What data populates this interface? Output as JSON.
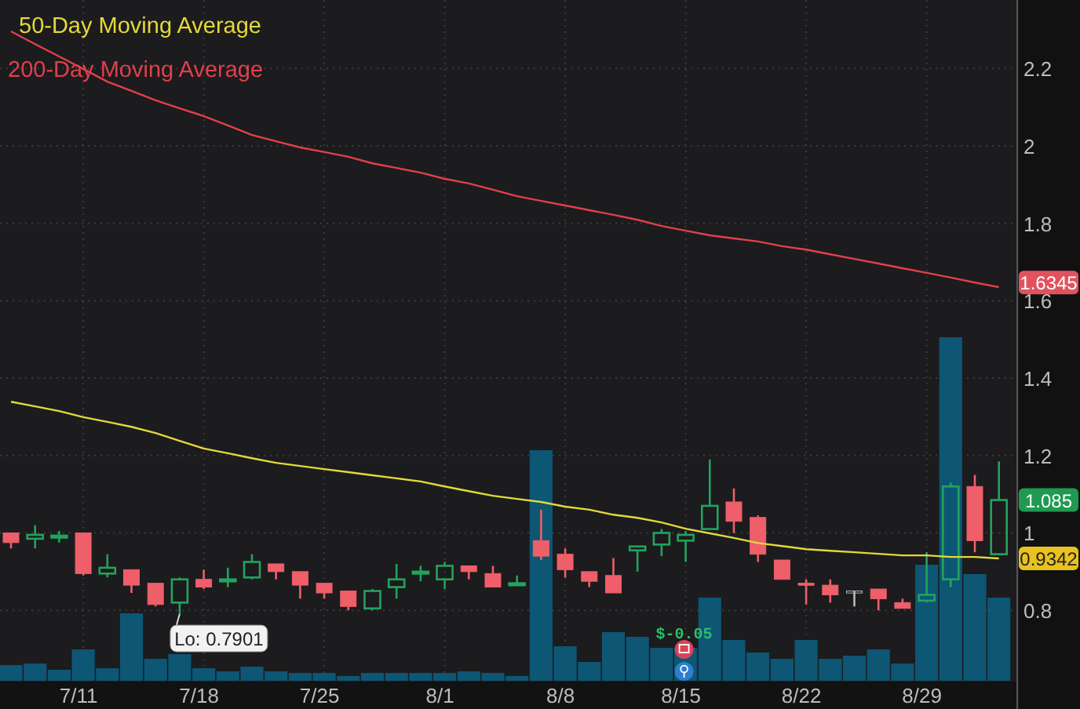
{
  "chart": {
    "price_labels": [
      {
        "kind": "ma200",
        "text": "1.6345",
        "color": "#e0535d"
      },
      {
        "kind": "close",
        "text": "1.085",
        "color": "#1f9a50"
      },
      {
        "kind": "ma50",
        "text": "0.9342",
        "color": "#e8c21e"
      }
    ],
    "chart_data": {
      "type": "candlestick",
      "categories": [
        null,
        null,
        null,
        "7/11",
        null,
        null,
        null,
        null,
        "7/18",
        null,
        null,
        null,
        null,
        "7/25",
        null,
        null,
        null,
        null,
        "8/1",
        null,
        null,
        null,
        null,
        "8/8",
        null,
        null,
        null,
        null,
        "8/15",
        null,
        null,
        null,
        null,
        "8/22",
        null,
        null,
        null,
        null,
        "8/29",
        null,
        null,
        null
      ],
      "grid": true,
      "yticks": [
        0.8,
        1,
        1.2,
        1.4,
        1.6,
        1.8,
        2,
        2.2
      ],
      "ylim": [
        0.618,
        2.377
      ],
      "series": [
        {
          "name": "50-Day Moving Average",
          "type": "line",
          "color": "#e3d93a",
          "values": [
            1.339,
            1.327,
            1.315,
            1.299,
            1.287,
            1.274,
            1.258,
            1.238,
            1.218,
            1.206,
            1.193,
            1.181,
            1.173,
            1.165,
            1.157,
            1.149,
            1.141,
            1.133,
            1.12,
            1.108,
            1.096,
            1.088,
            1.08,
            1.068,
            1.06,
            1.047,
            1.039,
            1.027,
            1.011,
            0.999,
            0.987,
            0.974,
            0.966,
            0.958,
            0.954,
            0.95,
            0.946,
            0.942,
            0.942,
            0.938,
            0.938,
            0.934
          ]
        },
        {
          "name": "200-Day Moving Average",
          "type": "line",
          "color": "#e0404c",
          "values": [
            2.296,
            2.263,
            2.231,
            2.199,
            2.166,
            2.142,
            2.118,
            2.097,
            2.077,
            2.053,
            2.028,
            2.012,
            1.996,
            1.984,
            1.972,
            1.955,
            1.943,
            1.931,
            1.915,
            1.903,
            1.887,
            1.87,
            1.858,
            1.846,
            1.834,
            1.822,
            1.809,
            1.793,
            1.781,
            1.769,
            1.761,
            1.753,
            1.741,
            1.732,
            1.72,
            1.708,
            1.696,
            1.684,
            1.672,
            1.66,
            1.647,
            1.635
          ]
        }
      ],
      "ohlc": [
        [
          1.0,
          1.0,
          0.96,
          0.975
        ],
        [
          0.985,
          1.02,
          0.96,
          0.995
        ],
        [
          0.99,
          1.005,
          0.975,
          0.993
        ],
        [
          1.0,
          1.0,
          0.89,
          0.895
        ],
        [
          0.895,
          0.945,
          0.885,
          0.91
        ],
        [
          0.905,
          0.905,
          0.845,
          0.865
        ],
        [
          0.87,
          0.87,
          0.81,
          0.815
        ],
        [
          0.82,
          0.885,
          0.7901,
          0.88
        ],
        [
          0.88,
          0.905,
          0.855,
          0.86
        ],
        [
          0.875,
          0.91,
          0.86,
          0.88
        ],
        [
          0.885,
          0.945,
          0.88,
          0.925
        ],
        [
          0.92,
          0.92,
          0.88,
          0.9
        ],
        [
          0.9,
          0.9,
          0.83,
          0.865
        ],
        [
          0.87,
          0.87,
          0.83,
          0.845
        ],
        [
          0.85,
          0.85,
          0.8,
          0.81
        ],
        [
          0.805,
          0.855,
          0.8,
          0.85
        ],
        [
          0.86,
          0.92,
          0.83,
          0.88
        ],
        [
          0.895,
          0.915,
          0.875,
          0.9
        ],
        [
          0.88,
          0.925,
          0.855,
          0.915
        ],
        [
          0.915,
          0.915,
          0.88,
          0.9
        ],
        [
          0.895,
          0.915,
          0.86,
          0.86
        ],
        [
          0.865,
          0.89,
          0.865,
          0.87
        ],
        [
          0.98,
          1.06,
          0.93,
          0.94
        ],
        [
          0.945,
          0.96,
          0.885,
          0.905
        ],
        [
          0.9,
          0.9,
          0.86,
          0.875
        ],
        [
          0.89,
          0.935,
          0.845,
          0.845
        ],
        [
          0.955,
          0.965,
          0.9,
          0.965
        ],
        [
          0.97,
          1.01,
          0.94,
          1.0
        ],
        [
          0.98,
          1.005,
          0.925,
          0.995
        ],
        [
          1.01,
          1.19,
          1.01,
          1.07
        ],
        [
          1.08,
          1.115,
          1.0,
          1.03
        ],
        [
          1.04,
          1.045,
          0.925,
          0.945
        ],
        [
          0.93,
          0.93,
          0.88,
          0.88
        ],
        [
          0.87,
          0.88,
          0.815,
          0.865
        ],
        [
          0.865,
          0.88,
          0.82,
          0.84
        ],
        [
          0.85,
          0.85,
          0.81,
          0.85
        ],
        [
          0.855,
          0.855,
          0.8,
          0.83
        ],
        [
          0.82,
          0.83,
          0.805,
          0.805
        ],
        [
          0.825,
          0.95,
          0.82,
          0.84
        ],
        [
          0.88,
          1.13,
          0.86,
          1.12
        ],
        [
          1.12,
          1.15,
          0.95,
          0.98
        ],
        [
          0.945,
          1.185,
          0.945,
          1.085
        ]
      ],
      "annotations": [
        "Lo: 0.7901",
        "$-0.05"
      ]
    }
  }
}
